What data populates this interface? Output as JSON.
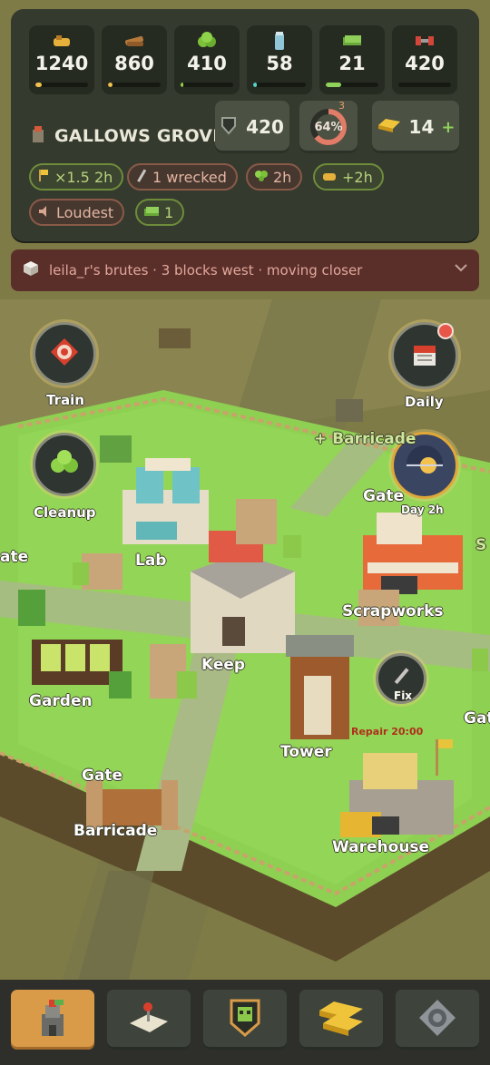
{
  "resources": [
    {
      "id": "food",
      "icon": "food-icon",
      "value": "1240",
      "fill": 0.12,
      "color": "#f2c14e"
    },
    {
      "id": "wood",
      "icon": "wood-icon",
      "value": "860",
      "fill": 0.08,
      "color": "#f2c14e"
    },
    {
      "id": "herbs",
      "icon": "herb-icon",
      "value": "410",
      "fill": 0.05,
      "color": "#9bd34b"
    },
    {
      "id": "water",
      "icon": "water-icon",
      "value": "58",
      "fill": 0.07,
      "color": "#58d0c8"
    },
    {
      "id": "cash",
      "icon": "cash-icon",
      "value": "21",
      "fill": 0.3,
      "color": "#8fd15a"
    },
    {
      "id": "fitness",
      "icon": "dumbbell-icon",
      "value": "420",
      "fill": 0.0,
      "color": "#e05a4a"
    }
  ],
  "town": {
    "name": "GALLOWS GROVE",
    "icon": "tower-icon"
  },
  "defense": {
    "value": "420",
    "icon": "shield-icon"
  },
  "morale": {
    "percent_text": "64%",
    "percent": 0.64,
    "badge": "3"
  },
  "gold": {
    "value": "14",
    "plus": "+",
    "icon": "gold-bar-icon"
  },
  "chips": [
    {
      "id": "boost",
      "style": "green",
      "icon": "flag-icon",
      "text": "×1.5 2h"
    },
    {
      "id": "wrecked",
      "style": "red",
      "icon": "wrench-icon",
      "text": "1 wrecked"
    },
    {
      "id": "herb-timer",
      "style": "green",
      "icon": "herb-icon",
      "text": "2h"
    },
    {
      "id": "food-timer",
      "style": "green",
      "icon": "food-icon",
      "text": "+2h"
    },
    {
      "id": "loudest",
      "style": "red",
      "icon": "speaker-icon",
      "text": "Loudest"
    },
    {
      "id": "cash-count",
      "style": "green",
      "icon": "cash-icon",
      "text": "1"
    }
  ],
  "alert": {
    "text": "leila_r's brutes · 3 blocks west · moving closer",
    "icon": "alert-cube-icon"
  },
  "side_buttons": {
    "train": "Train",
    "cleanup": "Cleanup",
    "daily": "Daily",
    "day": "Day 2h",
    "fix": "Fix"
  },
  "map_labels": {
    "barricade_top": "+ Barricade",
    "gate_right": "Gate",
    "lab": "Lab",
    "scrapworks": "Scrapworks",
    "keep": "Keep",
    "garden": "Garden",
    "tower": "Tower",
    "gate_bottom": "Gate",
    "barricade_bottom": "Barricade",
    "warehouse": "Warehouse",
    "gate_left_cut": "ate",
    "gate_far_right": "Gat",
    "s_far_right": "S",
    "repair": "Repair 20:00"
  },
  "nav": [
    {
      "id": "base",
      "icon": "base-tower-icon",
      "active": true
    },
    {
      "id": "map",
      "icon": "map-icon",
      "active": false
    },
    {
      "id": "squad",
      "icon": "zombie-badge-icon",
      "active": false
    },
    {
      "id": "shop",
      "icon": "gold-bars-icon",
      "active": false
    },
    {
      "id": "settings",
      "icon": "gear-icon",
      "active": false
    }
  ]
}
